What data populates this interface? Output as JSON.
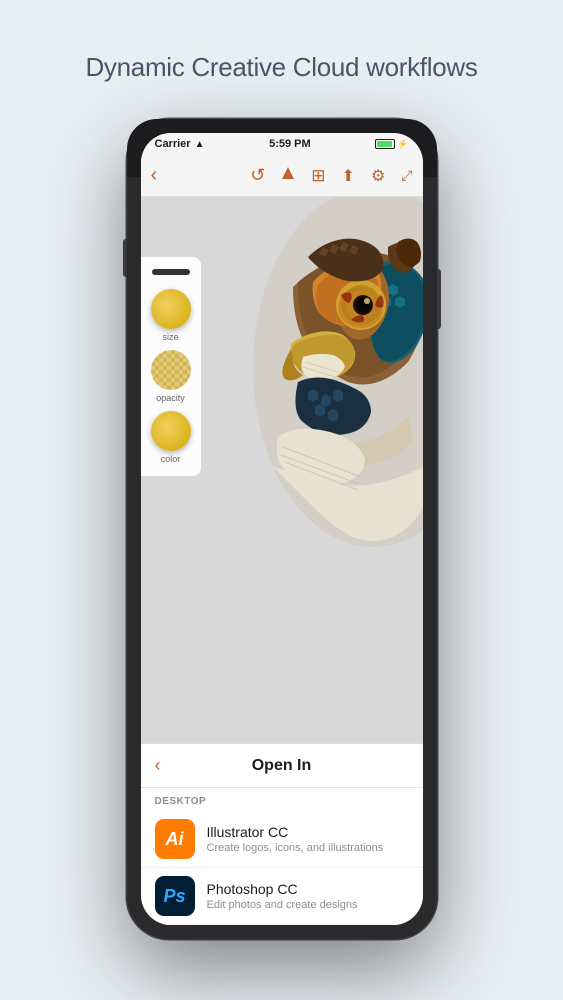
{
  "page": {
    "title": "Dynamic Creative Cloud workflows",
    "background_color": "#e8eef2"
  },
  "phone": {
    "status_bar": {
      "carrier": "Carrier",
      "wifi": true,
      "time": "5:59 PM",
      "battery_level": "full",
      "charging": true
    },
    "toolbar": {
      "back_label": "‹",
      "undo_label": "↺",
      "brush_label": "▲",
      "layers_label": "⊞",
      "share_label": "⬆",
      "settings_label": "⚙",
      "expand_label": "⤢"
    },
    "tools": {
      "size_label": "size",
      "opacity_label": "opacity",
      "color_label": "color"
    },
    "open_in_sheet": {
      "back_label": "‹",
      "title": "Open In",
      "section_label": "DESKTOP",
      "apps": [
        {
          "id": "illustrator",
          "icon_text": "Ai",
          "icon_bg": "#ff7c00",
          "name": "Illustrator CC",
          "description": "Create logos, icons, and illustrations"
        },
        {
          "id": "photoshop",
          "icon_text": "Ps",
          "icon_bg": "#001e36",
          "name": "Photoshop CC",
          "description": "Edit photos and create designs"
        }
      ]
    }
  }
}
